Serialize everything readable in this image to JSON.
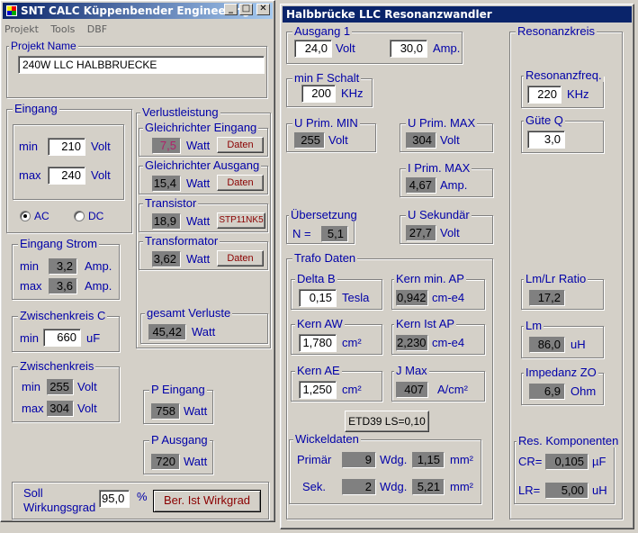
{
  "left_window": {
    "title": "SNT CALC  Küppenbender Engineering",
    "menu": [
      "Projekt",
      "Tools",
      "DBF"
    ],
    "projekt": {
      "label": "Projekt Name",
      "value": "240W LLC HALBBRUECKE"
    },
    "eingang": {
      "title": "Eingang",
      "min_label": "min",
      "min_value": "210",
      "max_label": "max",
      "max_value": "240",
      "unit": "Volt",
      "ac_label": "AC",
      "dc_label": "DC"
    },
    "eingang_strom": {
      "title": "Eingang Strom",
      "min_label": "min",
      "min_value": "3,2",
      "max_label": "max",
      "max_value": "3,6",
      "unit": "Amp."
    },
    "zwischenkreis_c": {
      "title": "Zwischenkreis C",
      "min_label": "min",
      "value": "660",
      "unit": "uF"
    },
    "zwischenkreis": {
      "title": "Zwischenkreis",
      "min_label": "min",
      "min_value": "255",
      "max_label": "max",
      "max_value": "304",
      "unit": "Volt"
    },
    "verlust": {
      "title": "Verlustleistung",
      "gleich_ein": {
        "title": "Gleichrichter Eingang",
        "value": "7,5",
        "unit": "Watt",
        "button": "Daten"
      },
      "gleich_aus": {
        "title": "Gleichrichter Ausgang",
        "value": "15,4",
        "unit": "Watt",
        "button": "Daten"
      },
      "transistor": {
        "title": "Transistor",
        "value": "18,9",
        "unit": "Watt",
        "button": "STP11NK5"
      },
      "transformator": {
        "title": "Transformator",
        "value": "3,62",
        "unit": "Watt",
        "button": "Daten"
      },
      "gesamt": {
        "title": "gesamt Verluste",
        "value": "45,42",
        "unit": "Watt"
      }
    },
    "p_eingang": {
      "title": "P Eingang",
      "value": "758",
      "unit": "Watt"
    },
    "p_ausgang": {
      "title": "P Ausgang",
      "value": "720",
      "unit": "Watt"
    },
    "wirkungsgrad": {
      "label_line1": "Soll",
      "label_line2": "Wirkungsgrad",
      "value": "95,0",
      "unit": "%",
      "button": "Ber. Ist Wirkgrad"
    }
  },
  "right_window": {
    "title": "Halbbrücke LLC Resonanzwandler",
    "ausgang": {
      "title": "Ausgang 1",
      "volt_value": "24,0",
      "volt_unit": "Volt",
      "amp_value": "30,0",
      "amp_unit": "Amp."
    },
    "min_f": {
      "title": "min F Schalt",
      "value": "200",
      "unit": "KHz"
    },
    "u_prim_min": {
      "title": "U Prim. MIN",
      "value": "255",
      "unit": "Volt"
    },
    "u_prim_max": {
      "title": "U Prim. MAX",
      "value": "304",
      "unit": "Volt"
    },
    "i_prim_max": {
      "title": "I Prim. MAX",
      "value": "4,67",
      "unit": "Amp."
    },
    "uebersetzung": {
      "title": "Übersetzung",
      "label": "N =",
      "value": "5,1"
    },
    "u_sekundaer": {
      "title": "U Sekundär",
      "value": "27,7",
      "unit": "Volt"
    },
    "trafo": {
      "title": "Trafo  Daten",
      "delta_b": {
        "title": "Delta B",
        "value": "0,15",
        "unit": "Tesla"
      },
      "kern_min_ap": {
        "title": "Kern min. AP",
        "value": "0,942",
        "unit": "cm-e4"
      },
      "kern_aw": {
        "title": "Kern AW",
        "value": "1,780",
        "unit": "cm²"
      },
      "kern_ist_ap": {
        "title": "Kern Ist AP",
        "value": "2,230",
        "unit": "cm-e4"
      },
      "kern_ae": {
        "title": "Kern AE",
        "value": "1,250",
        "unit": "cm²"
      },
      "j_max": {
        "title": "J Max",
        "value": "407",
        "unit": "A/cm²"
      },
      "core_button": "ETD39 LS=0,10",
      "wickel": {
        "title": "Wickeldaten",
        "primaer_label": "Primär",
        "primaer_wdg": "9",
        "primaer_mm": "1,15",
        "sek_label": "Sek.",
        "sek_wdg": "2",
        "sek_mm": "5,21",
        "wdg_unit": "Wdg.",
        "mm_unit": "mm²"
      }
    },
    "resonanzkreis": {
      "title": "Resonanzkreis",
      "freq": {
        "title": "Resonanzfreq.",
        "value": "220",
        "unit": "KHz"
      },
      "guete": {
        "title": "Güte Q",
        "value": "3,0"
      },
      "ratio": {
        "title": "Lm/Lr Ratio",
        "value": "17,2"
      },
      "lm": {
        "title": "Lm",
        "value": "86,0",
        "unit": "uH"
      },
      "impedanz": {
        "title": "Impedanz ZO",
        "value": "6,9",
        "unit": "Ohm"
      },
      "res_komp": {
        "title": "Res. Komponenten",
        "cr_label": "CR=",
        "cr_value": "0,105",
        "cr_unit": "µF",
        "lr_label": "LR=",
        "lr_value": "5,00",
        "lr_unit": "uH"
      }
    }
  }
}
